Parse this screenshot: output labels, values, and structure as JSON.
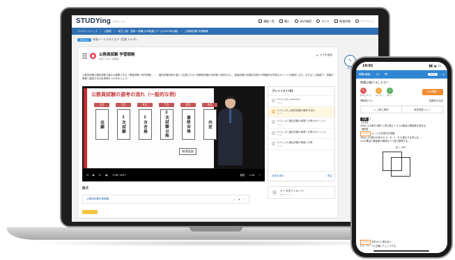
{
  "header": {
    "logo": "STUDYing",
    "logo_sub": "スタディング",
    "nav": [
      "講座一覧",
      "購入",
      "Q&A検索",
      "ガイド",
      "勉強仲間",
      "マイページ"
    ]
  },
  "breadcrumb": [
    "マイページトップ",
    "公務員",
    "地方上級・国家一般職(大卒程度)コース(2023年合格)",
    "公務員試験 学習戦略"
  ],
  "notice": {
    "tag": "お知らせ",
    "text": "新着メールがあります (受講 109 件)"
  },
  "lesson": {
    "title": "公務員試験 学習戦略",
    "subtitle": "講座 53分 / 講義数",
    "memo": "メモを追加",
    "description": "公務員試験の筆記試験で最大の難関である「教養試験＋専門試験」・・・筆記試験対策を通じて出題される一般教養試験の全体像と傾向を示し、勉強時間の効果的な配分や戦略的な学習のポイントを解説します。まずはこの講座で、試験の概要と勉強方法の全体像をつかみましょう！"
  },
  "slide": {
    "title": "公務員試験の選考の流れ（一般的な例）",
    "steps": [
      {
        "month": "3月",
        "label": "出願"
      },
      {
        "month": "5月",
        "label": "1次試験"
      },
      {
        "month": "6月",
        "label": "1次合格"
      },
      {
        "month": "7月",
        "label": "2次試験以降"
      },
      {
        "month": "8月",
        "label": "最終合格"
      },
      {
        "month": "9月",
        "label": "内定"
      }
    ],
    "interview": "採用面談"
  },
  "player": {
    "time": "1:56 / 8:07",
    "speed": "1.0x",
    "progress": 0.24,
    "quality": "設定"
  },
  "playlist": {
    "title": "プレイリスト(4)",
    "items": [
      {
        "label": "0-0-1_00_Contents",
        "time": "0:15",
        "active": false
      },
      {
        "label": "0-0-1_00_公務員試験の選考の流れ",
        "time": "8:07",
        "active": true
      },
      {
        "label": "0-0-1_01_筆記試験の概要と対策のポイント1",
        "time": "6:14",
        "active": false
      },
      {
        "label": "0-0-1_02_筆記試験の概要と対策のポイント2",
        "time": "5:31",
        "active": false
      },
      {
        "label": "0-0-1_03_筆記試験の概要と対策",
        "time": "4:02",
        "active": false
      }
    ],
    "footer_left": "全体を表示",
    "footer_right": "再生"
  },
  "book": {
    "heading": "冊子",
    "item": "公務員試験学習戦略"
  },
  "download": {
    "title": "データダウンロード",
    "sub": "PDFファイル"
  },
  "side_button": {
    "label": "学習メモ"
  },
  "phone": {
    "time": "19:02",
    "bar_items": [
      "問題(練習)",
      "1/1",
      "問"
    ],
    "progress_label": "50%",
    "question": "問題は解けましたか？",
    "choices": [
      {
        "mark": "×",
        "label": "解けなかった",
        "color": "#e05a5a"
      },
      {
        "mark": "△",
        "label": "あいまい",
        "color": "#f0a537"
      },
      {
        "mark": "○",
        "label": "解けた",
        "color": "#4fae5b"
      }
    ],
    "next_button": "次の問題へ",
    "flag_left": "理解度(1/1)",
    "flag_right": "重要度を追加",
    "nav_prev": "< 上解と解説",
    "nav_next": "解答履歴 (1) >",
    "body_tag": "正解",
    "body_answer": "2",
    "body_lines": [
      "【方針】",
      "200以上の数を3通りに書き換えて 4つの集合の要素数を求める。",
      "【解説】",
      "キーとなる条件を把握",
      "200以上の数の分布から A・B・C・D の重なりを考える。",
      "4つの集合の要素数の関係をベン図で整理する。"
    ],
    "diagram_title": "全 = 200",
    "footer_lines": [
      "条件から人数を記入",
      "P キーページに正確にチェックする。"
    ]
  }
}
